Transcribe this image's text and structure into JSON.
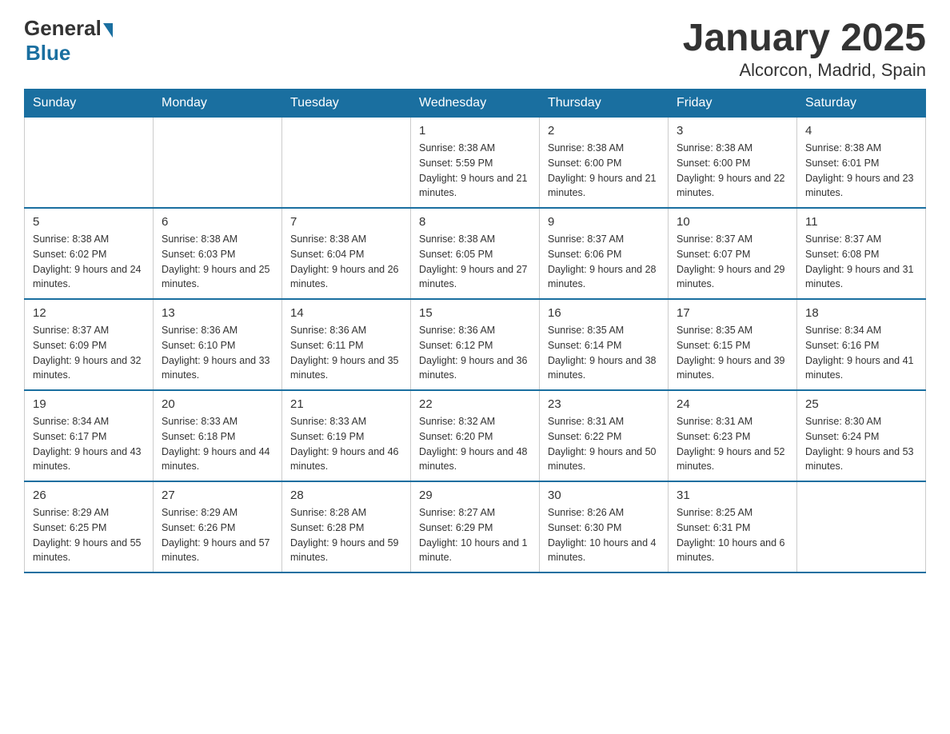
{
  "logo": {
    "general": "General",
    "blue": "Blue"
  },
  "title": "January 2025",
  "subtitle": "Alcorcon, Madrid, Spain",
  "headers": [
    "Sunday",
    "Monday",
    "Tuesday",
    "Wednesday",
    "Thursday",
    "Friday",
    "Saturday"
  ],
  "weeks": [
    [
      {
        "day": "",
        "sunrise": "",
        "sunset": "",
        "daylight": ""
      },
      {
        "day": "",
        "sunrise": "",
        "sunset": "",
        "daylight": ""
      },
      {
        "day": "",
        "sunrise": "",
        "sunset": "",
        "daylight": ""
      },
      {
        "day": "1",
        "sunrise": "Sunrise: 8:38 AM",
        "sunset": "Sunset: 5:59 PM",
        "daylight": "Daylight: 9 hours and 21 minutes."
      },
      {
        "day": "2",
        "sunrise": "Sunrise: 8:38 AM",
        "sunset": "Sunset: 6:00 PM",
        "daylight": "Daylight: 9 hours and 21 minutes."
      },
      {
        "day": "3",
        "sunrise": "Sunrise: 8:38 AM",
        "sunset": "Sunset: 6:00 PM",
        "daylight": "Daylight: 9 hours and 22 minutes."
      },
      {
        "day": "4",
        "sunrise": "Sunrise: 8:38 AM",
        "sunset": "Sunset: 6:01 PM",
        "daylight": "Daylight: 9 hours and 23 minutes."
      }
    ],
    [
      {
        "day": "5",
        "sunrise": "Sunrise: 8:38 AM",
        "sunset": "Sunset: 6:02 PM",
        "daylight": "Daylight: 9 hours and 24 minutes."
      },
      {
        "day": "6",
        "sunrise": "Sunrise: 8:38 AM",
        "sunset": "Sunset: 6:03 PM",
        "daylight": "Daylight: 9 hours and 25 minutes."
      },
      {
        "day": "7",
        "sunrise": "Sunrise: 8:38 AM",
        "sunset": "Sunset: 6:04 PM",
        "daylight": "Daylight: 9 hours and 26 minutes."
      },
      {
        "day": "8",
        "sunrise": "Sunrise: 8:38 AM",
        "sunset": "Sunset: 6:05 PM",
        "daylight": "Daylight: 9 hours and 27 minutes."
      },
      {
        "day": "9",
        "sunrise": "Sunrise: 8:37 AM",
        "sunset": "Sunset: 6:06 PM",
        "daylight": "Daylight: 9 hours and 28 minutes."
      },
      {
        "day": "10",
        "sunrise": "Sunrise: 8:37 AM",
        "sunset": "Sunset: 6:07 PM",
        "daylight": "Daylight: 9 hours and 29 minutes."
      },
      {
        "day": "11",
        "sunrise": "Sunrise: 8:37 AM",
        "sunset": "Sunset: 6:08 PM",
        "daylight": "Daylight: 9 hours and 31 minutes."
      }
    ],
    [
      {
        "day": "12",
        "sunrise": "Sunrise: 8:37 AM",
        "sunset": "Sunset: 6:09 PM",
        "daylight": "Daylight: 9 hours and 32 minutes."
      },
      {
        "day": "13",
        "sunrise": "Sunrise: 8:36 AM",
        "sunset": "Sunset: 6:10 PM",
        "daylight": "Daylight: 9 hours and 33 minutes."
      },
      {
        "day": "14",
        "sunrise": "Sunrise: 8:36 AM",
        "sunset": "Sunset: 6:11 PM",
        "daylight": "Daylight: 9 hours and 35 minutes."
      },
      {
        "day": "15",
        "sunrise": "Sunrise: 8:36 AM",
        "sunset": "Sunset: 6:12 PM",
        "daylight": "Daylight: 9 hours and 36 minutes."
      },
      {
        "day": "16",
        "sunrise": "Sunrise: 8:35 AM",
        "sunset": "Sunset: 6:14 PM",
        "daylight": "Daylight: 9 hours and 38 minutes."
      },
      {
        "day": "17",
        "sunrise": "Sunrise: 8:35 AM",
        "sunset": "Sunset: 6:15 PM",
        "daylight": "Daylight: 9 hours and 39 minutes."
      },
      {
        "day": "18",
        "sunrise": "Sunrise: 8:34 AM",
        "sunset": "Sunset: 6:16 PM",
        "daylight": "Daylight: 9 hours and 41 minutes."
      }
    ],
    [
      {
        "day": "19",
        "sunrise": "Sunrise: 8:34 AM",
        "sunset": "Sunset: 6:17 PM",
        "daylight": "Daylight: 9 hours and 43 minutes."
      },
      {
        "day": "20",
        "sunrise": "Sunrise: 8:33 AM",
        "sunset": "Sunset: 6:18 PM",
        "daylight": "Daylight: 9 hours and 44 minutes."
      },
      {
        "day": "21",
        "sunrise": "Sunrise: 8:33 AM",
        "sunset": "Sunset: 6:19 PM",
        "daylight": "Daylight: 9 hours and 46 minutes."
      },
      {
        "day": "22",
        "sunrise": "Sunrise: 8:32 AM",
        "sunset": "Sunset: 6:20 PM",
        "daylight": "Daylight: 9 hours and 48 minutes."
      },
      {
        "day": "23",
        "sunrise": "Sunrise: 8:31 AM",
        "sunset": "Sunset: 6:22 PM",
        "daylight": "Daylight: 9 hours and 50 minutes."
      },
      {
        "day": "24",
        "sunrise": "Sunrise: 8:31 AM",
        "sunset": "Sunset: 6:23 PM",
        "daylight": "Daylight: 9 hours and 52 minutes."
      },
      {
        "day": "25",
        "sunrise": "Sunrise: 8:30 AM",
        "sunset": "Sunset: 6:24 PM",
        "daylight": "Daylight: 9 hours and 53 minutes."
      }
    ],
    [
      {
        "day": "26",
        "sunrise": "Sunrise: 8:29 AM",
        "sunset": "Sunset: 6:25 PM",
        "daylight": "Daylight: 9 hours and 55 minutes."
      },
      {
        "day": "27",
        "sunrise": "Sunrise: 8:29 AM",
        "sunset": "Sunset: 6:26 PM",
        "daylight": "Daylight: 9 hours and 57 minutes."
      },
      {
        "day": "28",
        "sunrise": "Sunrise: 8:28 AM",
        "sunset": "Sunset: 6:28 PM",
        "daylight": "Daylight: 9 hours and 59 minutes."
      },
      {
        "day": "29",
        "sunrise": "Sunrise: 8:27 AM",
        "sunset": "Sunset: 6:29 PM",
        "daylight": "Daylight: 10 hours and 1 minute."
      },
      {
        "day": "30",
        "sunrise": "Sunrise: 8:26 AM",
        "sunset": "Sunset: 6:30 PM",
        "daylight": "Daylight: 10 hours and 4 minutes."
      },
      {
        "day": "31",
        "sunrise": "Sunrise: 8:25 AM",
        "sunset": "Sunset: 6:31 PM",
        "daylight": "Daylight: 10 hours and 6 minutes."
      },
      {
        "day": "",
        "sunrise": "",
        "sunset": "",
        "daylight": ""
      }
    ]
  ]
}
